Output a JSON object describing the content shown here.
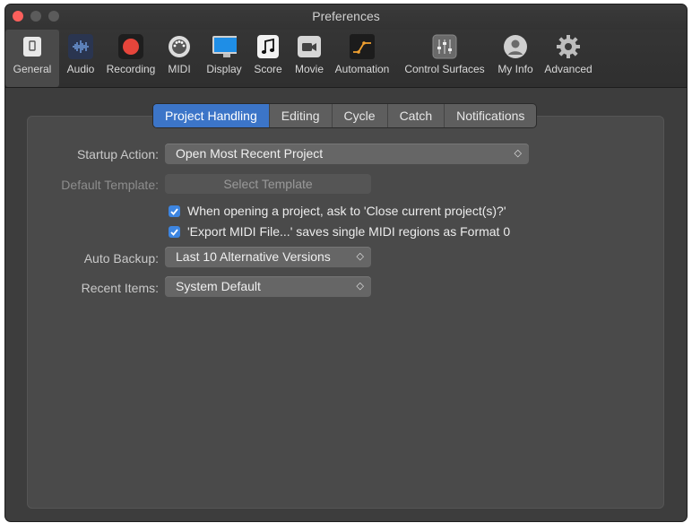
{
  "window": {
    "title": "Preferences"
  },
  "toolbar": {
    "items": [
      {
        "label": "General",
        "icon": "general-switch-icon",
        "selected": true
      },
      {
        "label": "Audio",
        "icon": "audio-waveform-icon"
      },
      {
        "label": "Recording",
        "icon": "record-icon"
      },
      {
        "label": "MIDI",
        "icon": "midi-port-icon"
      },
      {
        "label": "Display",
        "icon": "display-monitor-icon"
      },
      {
        "label": "Score",
        "icon": "music-note-icon"
      },
      {
        "label": "Movie",
        "icon": "movie-camera-icon"
      },
      {
        "label": "Automation",
        "icon": "automation-icon"
      },
      {
        "label": "Control Surfaces",
        "icon": "control-surfaces-icon"
      },
      {
        "label": "My Info",
        "icon": "user-icon"
      },
      {
        "label": "Advanced",
        "icon": "gear-icon"
      }
    ]
  },
  "tabs": [
    {
      "label": "Project Handling",
      "active": true
    },
    {
      "label": "Editing"
    },
    {
      "label": "Cycle"
    },
    {
      "label": "Catch"
    },
    {
      "label": "Notifications"
    }
  ],
  "form": {
    "startup_action": {
      "label": "Startup Action:",
      "value": "Open Most Recent Project"
    },
    "default_template": {
      "label": "Default Template:",
      "button": "Select Template"
    },
    "check_close_project": {
      "label": "When opening a project, ask to 'Close current project(s)?'",
      "checked": true
    },
    "check_export_midi": {
      "label": "'Export MIDI File...' saves single MIDI regions as Format 0",
      "checked": true
    },
    "auto_backup": {
      "label": "Auto Backup:",
      "value": "Last 10 Alternative Versions"
    },
    "recent_items": {
      "label": "Recent Items:",
      "value": "System Default"
    }
  },
  "colors": {
    "accent": "#3c75c8",
    "checkbox": "#3d85e0",
    "close": "#fc605c",
    "record": "#e5453b"
  }
}
